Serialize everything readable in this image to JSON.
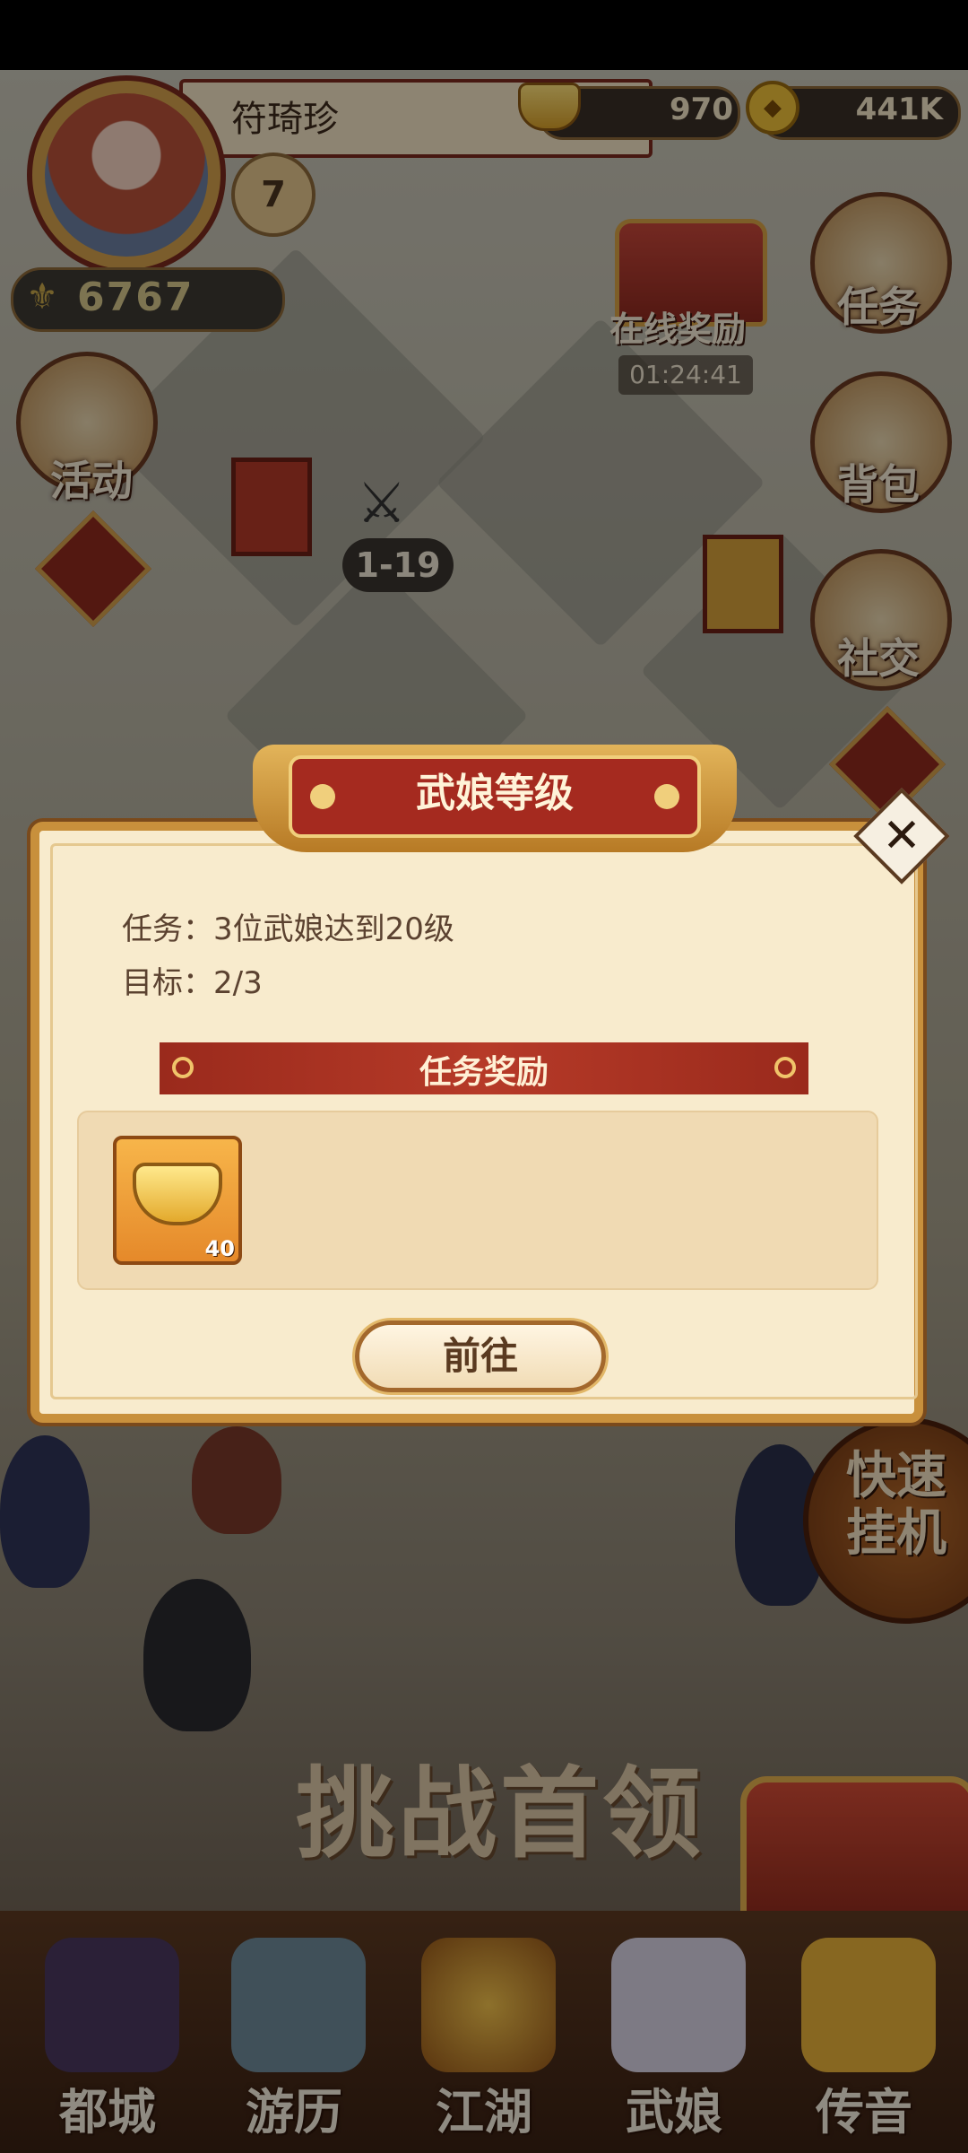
{
  "player": {
    "name": "符琦珍",
    "level": "7",
    "power": "6767"
  },
  "currency": {
    "ingots": "970",
    "coins": "441K",
    "coin_icon": "coin-icon",
    "ingot_icon": "gold-ingot-icon"
  },
  "left_menu": [
    {
      "label": "活动",
      "icon": "gift-box-icon"
    }
  ],
  "right_menu": [
    {
      "label": "任务",
      "icon": "scroll-icon"
    },
    {
      "label": "背包",
      "icon": "backpack-icon"
    },
    {
      "label": "社交",
      "icon": "teapot-icon"
    }
  ],
  "online_reward": {
    "label": "在线奖励",
    "timer": "01:24:41"
  },
  "stage": {
    "label": "1-19"
  },
  "quick_idle": {
    "label": "快速挂机"
  },
  "boss": {
    "label": "挑战首领"
  },
  "bottom_nav": [
    {
      "label": "都城",
      "icon": "pagoda-icon"
    },
    {
      "label": "游历",
      "icon": "dragon-icon"
    },
    {
      "label": "江湖",
      "icon": "crossed-swords-icon"
    },
    {
      "label": "武娘",
      "icon": "heroine-icon"
    },
    {
      "label": "传音",
      "icon": "chicken-icon"
    }
  ],
  "dialog": {
    "title": "武娘等级",
    "task": "任务：3位武娘达到20级",
    "target": "目标：2/3",
    "reward_header": "任务奖励",
    "rewards": [
      {
        "item": "gold-ingot",
        "count": "40"
      }
    ],
    "go_button": "前往"
  },
  "colors": {
    "accent_red": "#a52a1f",
    "gold": "#d4a04c",
    "parchment": "#f8ebcd"
  }
}
